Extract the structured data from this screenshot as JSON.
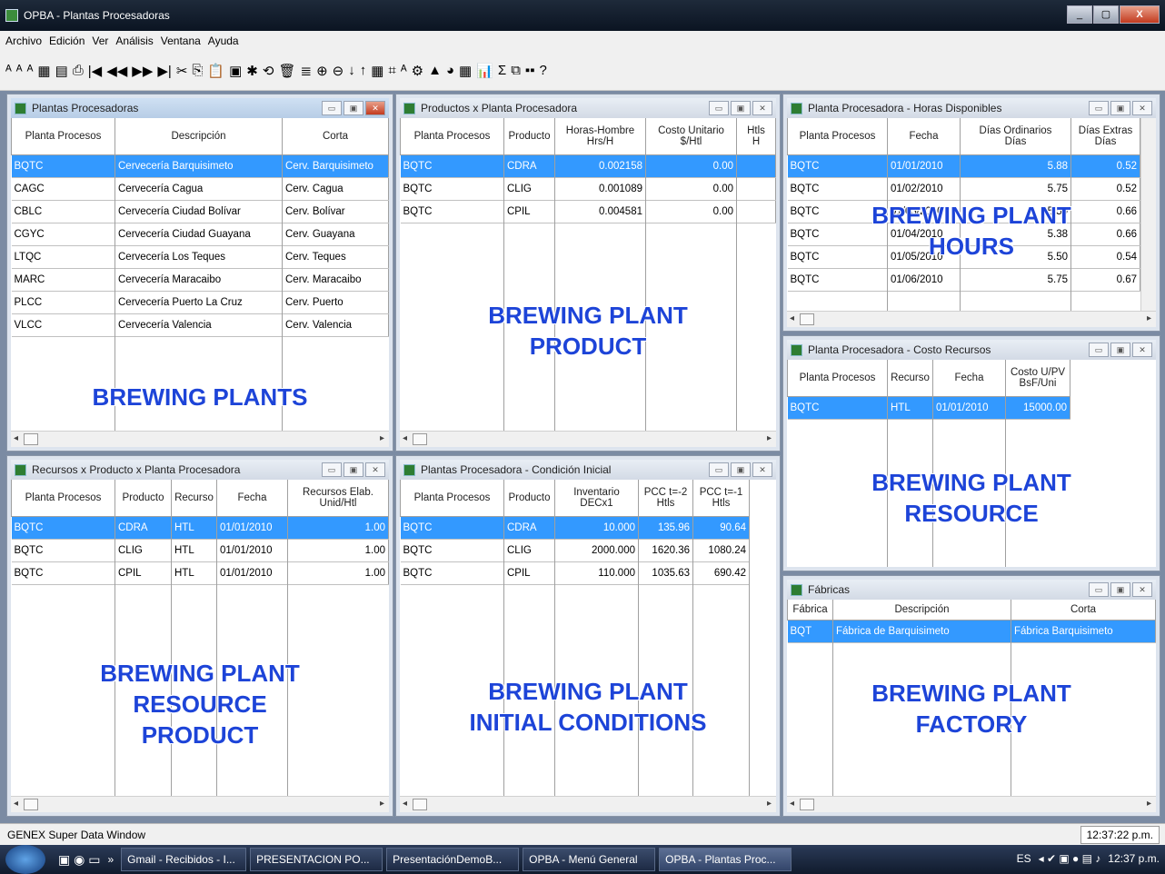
{
  "window": {
    "title": "OPBA - Plantas Procesadoras",
    "min": "_",
    "max": "▢",
    "close": "X"
  },
  "menu": [
    "Archivo",
    "Edición",
    "Ver",
    "Análisis",
    "Ventana",
    "Ayuda"
  ],
  "toolbar_icons": [
    "filter-icon",
    "filter-add-icon",
    "filter-remove-icon",
    "grid-icon",
    "form-icon",
    "print-icon",
    "first-record-icon",
    "prev-record-icon",
    "next-record-icon",
    "last-record-icon",
    "cut-icon",
    "copy-icon",
    "paste-icon",
    "new-icon",
    "delete-icon",
    "undo-icon",
    "trash-icon",
    "list-icon",
    "zoom-in-icon",
    "zoom-out-icon",
    "sort-asc-icon",
    "sort-desc-icon",
    "table-icon",
    "chart-icon",
    "filter2-icon",
    "settings-icon",
    "bar-chart-icon",
    "pie-chart-icon",
    "calc-icon",
    "graph-icon",
    "sum-icon",
    "tile-icon",
    "grid2-icon",
    "help-icon"
  ],
  "toolbar_glyphs": [
    "ᴬ",
    "ᴬ",
    "ᴬ",
    "▦",
    "▤",
    "⎙",
    "|◀",
    "◀◀",
    "▶▶",
    "▶|",
    "✂",
    "⎘",
    "📋",
    "▣",
    "✱",
    "⟲",
    "🗑",
    "≣",
    "⊕",
    "⊖",
    "↓",
    "↑",
    "▦",
    "⌗",
    "ᴬ",
    "⚙",
    "▲",
    "◕",
    "▦",
    "📊",
    "Σ",
    "⧉",
    "▪▪",
    "?"
  ],
  "win1": {
    "title": "Plantas Procesadoras",
    "cols": [
      "Planta Procesos",
      "Descripción",
      "Corta"
    ],
    "rows": [
      [
        "BQTC",
        "Cervecería Barquisimeto",
        "Cerv. Barquisimeto"
      ],
      [
        "CAGC",
        "Cervecería Cagua",
        "Cerv. Cagua"
      ],
      [
        "CBLC",
        "Cervecería Ciudad Bolívar",
        "Cerv. Bolívar"
      ],
      [
        "CGYC",
        "Cervecería Ciudad Guayana",
        "Cerv. Guayana"
      ],
      [
        "LTQC",
        "Cervecería Los Teques",
        "Cerv. Teques"
      ],
      [
        "MARC",
        "Cervecería Maracaibo",
        "Cerv. Maracaibo"
      ],
      [
        "PLCC",
        "Cervecería Puerto La Cruz",
        "Cerv. Puerto"
      ],
      [
        "VLCC",
        "Cervecería Valencia",
        "Cerv. Valencia"
      ]
    ],
    "overlay": "BREWING PLANTS"
  },
  "win2": {
    "title": "Productos x Planta Procesadora",
    "cols": [
      "Planta Procesos",
      "Producto",
      "Horas-Hombre\nHrs/H",
      "Costo Unitario\n$/Htl",
      "Htls\nH"
    ],
    "rows": [
      [
        "BQTC",
        "CDRA",
        "0.002158",
        "0.00",
        ""
      ],
      [
        "BQTC",
        "CLIG",
        "0.001089",
        "0.00",
        ""
      ],
      [
        "BQTC",
        "CPIL",
        "0.004581",
        "0.00",
        ""
      ]
    ],
    "overlay": [
      "BREWING PLANT",
      "PRODUCT"
    ]
  },
  "win3": {
    "title": "Planta Procesadora - Horas Disponibles",
    "cols": [
      "Planta Procesos",
      "Fecha",
      "Días Ordinarios\nDías",
      "Días Extras\nDías"
    ],
    "rows": [
      [
        "BQTC",
        "01/01/2010",
        "5.88",
        "0.52"
      ],
      [
        "BQTC",
        "01/02/2010",
        "5.75",
        "0.52"
      ],
      [
        "BQTC",
        "01/03/2010",
        "5.50",
        "0.66"
      ],
      [
        "BQTC",
        "01/04/2010",
        "5.38",
        "0.66"
      ],
      [
        "BQTC",
        "01/05/2010",
        "5.50",
        "0.54"
      ],
      [
        "BQTC",
        "01/06/2010",
        "5.75",
        "0.67"
      ]
    ],
    "overlay": [
      "BREWING PLANT",
      "HOURS"
    ]
  },
  "win4": {
    "title": "Planta Procesadora - Costo Recursos",
    "cols": [
      "Planta Procesos",
      "Recurso",
      "Fecha",
      "Costo U/PV\nBsF/Uni"
    ],
    "rows": [
      [
        "BQTC",
        "HTL",
        "01/01/2010",
        "15000.00"
      ]
    ],
    "overlay": [
      "BREWING PLANT",
      "RESOURCE"
    ]
  },
  "win5": {
    "title": "Recursos x Producto x Planta Procesadora",
    "cols": [
      "Planta Procesos",
      "Producto",
      "Recurso",
      "Fecha",
      "Recursos Elab.\nUnid/Htl"
    ],
    "rows": [
      [
        "BQTC",
        "CDRA",
        "HTL",
        "01/01/2010",
        "1.00"
      ],
      [
        "BQTC",
        "CLIG",
        "HTL",
        "01/01/2010",
        "1.00"
      ],
      [
        "BQTC",
        "CPIL",
        "HTL",
        "01/01/2010",
        "1.00"
      ]
    ],
    "overlay": [
      "BREWING PLANT",
      "RESOURCE",
      "PRODUCT"
    ]
  },
  "win6": {
    "title": "Plantas Procesadora - Condición Inicial",
    "cols": [
      "Planta Procesos",
      "Producto",
      "Inventario\nDECx1",
      "PCC t=-2\nHtls",
      "PCC t=-1\nHtls"
    ],
    "rows": [
      [
        "BQTC",
        "CDRA",
        "10.000",
        "135.96",
        "90.64"
      ],
      [
        "BQTC",
        "CLIG",
        "2000.000",
        "1620.36",
        "1080.24"
      ],
      [
        "BQTC",
        "CPIL",
        "110.000",
        "1035.63",
        "690.42"
      ]
    ],
    "overlay": [
      "BREWING PLANT",
      "INITIAL CONDITIONS"
    ]
  },
  "win7": {
    "title": "Fábricas",
    "cols": [
      "Fábrica",
      "Descripción",
      "Corta"
    ],
    "rows": [
      [
        "BQT",
        "Fábrica de Barquisimeto",
        "Fábrica Barquisimeto"
      ]
    ],
    "overlay": [
      "BREWING PLANT",
      "FACTORY"
    ]
  },
  "status": {
    "text": "GENEX Super Data Window",
    "time": "12:37:22 p.m."
  },
  "taskbar": {
    "items": [
      "Gmail - Recibidos - I...",
      "PRESENTACION PO...",
      "PresentaciónDemoB...",
      "OPBA - Menú General",
      "OPBA - Plantas Proc..."
    ],
    "lang": "ES",
    "clock": "12:37 p.m.",
    "chevron": "»"
  }
}
